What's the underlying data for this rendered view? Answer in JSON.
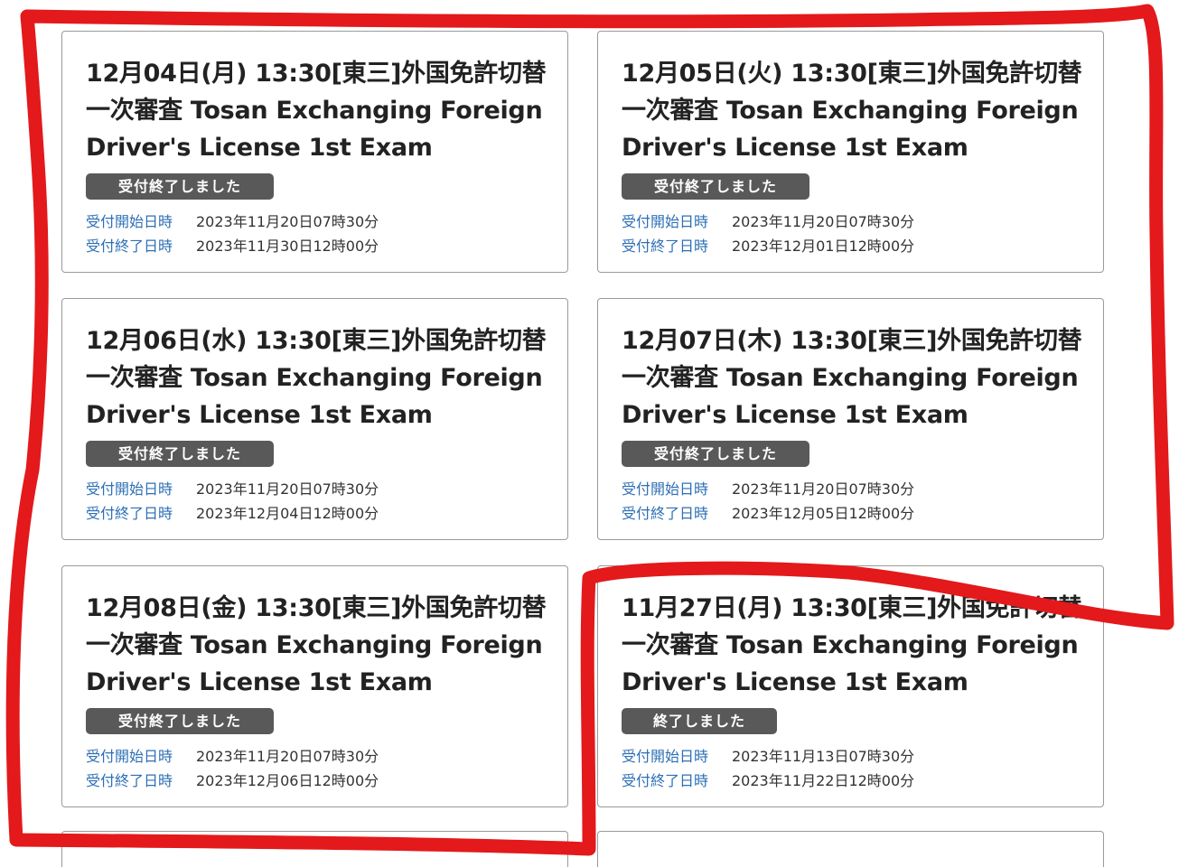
{
  "labels": {
    "start": "受付開始日時",
    "end": "受付終了日時"
  },
  "cards": [
    {
      "title": "12月04日(月) 13:30[東三]外国免許切替一次審査 Tosan Exchanging Foreign Driver's License 1st Exam",
      "status": "受付終了しました",
      "start": "2023年11月20日07時30分",
      "end": "2023年11月30日12時00分"
    },
    {
      "title": "12月05日(火) 13:30[東三]外国免許切替一次審査 Tosan Exchanging Foreign Driver's License 1st Exam",
      "status": "受付終了しました",
      "start": "2023年11月20日07時30分",
      "end": "2023年12月01日12時00分"
    },
    {
      "title": "12月06日(水) 13:30[東三]外国免許切替一次審査 Tosan Exchanging Foreign Driver's License 1st Exam",
      "status": "受付終了しました",
      "start": "2023年11月20日07時30分",
      "end": "2023年12月04日12時00分"
    },
    {
      "title": "12月07日(木) 13:30[東三]外国免許切替一次審査 Tosan Exchanging Foreign Driver's License 1st Exam",
      "status": "受付終了しました",
      "start": "2023年11月20日07時30分",
      "end": "2023年12月05日12時00分"
    },
    {
      "title": "12月08日(金) 13:30[東三]外国免許切替一次審査 Tosan Exchanging Foreign Driver's License 1st Exam",
      "status": "受付終了しました",
      "start": "2023年11月20日07時30分",
      "end": "2023年12月06日12時00分"
    },
    {
      "title": "11月27日(月) 13:30[東三]外国免許切替一次審査 Tosan Exchanging Foreign Driver's License 1st Exam",
      "status": "終了しました",
      "start": "2023年11月13日07時30分",
      "end": "2023年11月22日12時00分"
    }
  ],
  "colors": {
    "annotation": "#e3191b",
    "label": "#2d6fb5",
    "badge": "#595959"
  }
}
